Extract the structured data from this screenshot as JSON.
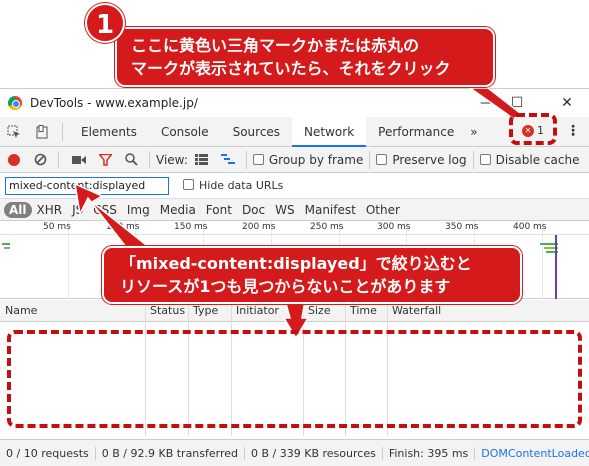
{
  "annotations": {
    "badge_number": "1",
    "callout1_line1": "ここに黄色い三角マークかまたは赤丸の",
    "callout1_line2": "マークが表示されていたら、それをクリック",
    "callout2_line1": "「mixed-content:displayed」で絞り込むと",
    "callout2_line2": "リソースが1つも見つからないことがあります"
  },
  "window": {
    "title": "DevTools - www.example.jp/",
    "minimize": "—",
    "maximize": "☐",
    "close": "✕"
  },
  "tabs": {
    "items": [
      "Elements",
      "Console",
      "Sources",
      "Network",
      "Performance"
    ],
    "active": "Network",
    "more": "»",
    "error_count": "1",
    "menu": "⋮"
  },
  "toolbar": {
    "view_label": "View:",
    "group_by_frame": "Group by frame",
    "preserve_log": "Preserve log",
    "disable_cache": "Disable cache"
  },
  "filter": {
    "value": "mixed-content:displayed",
    "hide_data_urls": "Hide data URLs"
  },
  "type_filters": [
    "All",
    "XHR",
    "JS",
    "CSS",
    "Img",
    "Media",
    "Font",
    "Doc",
    "WS",
    "Manifest",
    "Other"
  ],
  "overview": {
    "ticks": [
      "50 ms",
      "100 ms",
      "150 ms",
      "200 ms",
      "250 ms",
      "300 ms",
      "350 ms",
      "400 ms"
    ]
  },
  "columns": [
    "Name",
    "Status",
    "Type",
    "Initiator",
    "Size",
    "Time",
    "Waterfall"
  ],
  "status": {
    "requests": "0 / 10 requests",
    "transferred": "0 B / 92.9 KB transferred",
    "resources": "0 B / 339 KB resources",
    "finish": "Finish: 395 ms",
    "dom_content_loaded": "DOMContentLoaded"
  },
  "colors": {
    "accent": "#1a73e8",
    "annotation_red": "#d41a1a",
    "record_red": "#d93025"
  }
}
